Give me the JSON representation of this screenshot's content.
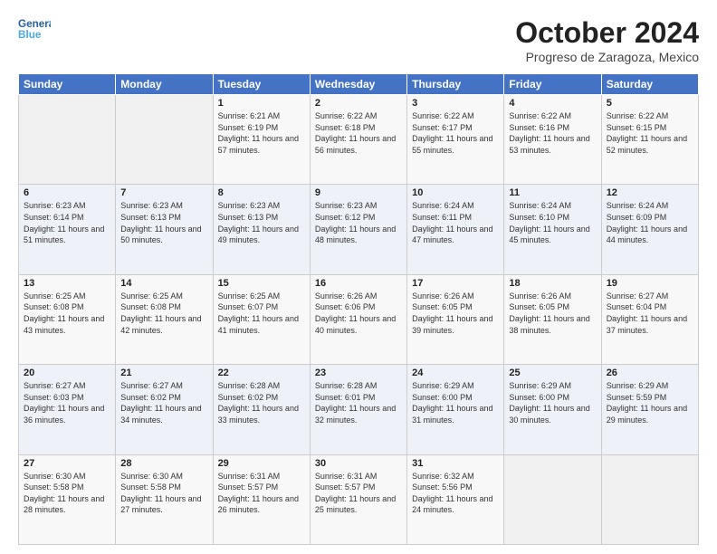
{
  "header": {
    "month_title": "October 2024",
    "location": "Progreso de Zaragoza, Mexico",
    "logo_general": "General",
    "logo_blue": "Blue"
  },
  "days_of_week": [
    "Sunday",
    "Monday",
    "Tuesday",
    "Wednesday",
    "Thursday",
    "Friday",
    "Saturday"
  ],
  "weeks": [
    [
      {
        "day": "",
        "sunrise": "",
        "sunset": "",
        "daylight": ""
      },
      {
        "day": "",
        "sunrise": "",
        "sunset": "",
        "daylight": ""
      },
      {
        "day": "1",
        "sunrise": "Sunrise: 6:21 AM",
        "sunset": "Sunset: 6:19 PM",
        "daylight": "Daylight: 11 hours and 57 minutes."
      },
      {
        "day": "2",
        "sunrise": "Sunrise: 6:22 AM",
        "sunset": "Sunset: 6:18 PM",
        "daylight": "Daylight: 11 hours and 56 minutes."
      },
      {
        "day": "3",
        "sunrise": "Sunrise: 6:22 AM",
        "sunset": "Sunset: 6:17 PM",
        "daylight": "Daylight: 11 hours and 55 minutes."
      },
      {
        "day": "4",
        "sunrise": "Sunrise: 6:22 AM",
        "sunset": "Sunset: 6:16 PM",
        "daylight": "Daylight: 11 hours and 53 minutes."
      },
      {
        "day": "5",
        "sunrise": "Sunrise: 6:22 AM",
        "sunset": "Sunset: 6:15 PM",
        "daylight": "Daylight: 11 hours and 52 minutes."
      }
    ],
    [
      {
        "day": "6",
        "sunrise": "Sunrise: 6:23 AM",
        "sunset": "Sunset: 6:14 PM",
        "daylight": "Daylight: 11 hours and 51 minutes."
      },
      {
        "day": "7",
        "sunrise": "Sunrise: 6:23 AM",
        "sunset": "Sunset: 6:13 PM",
        "daylight": "Daylight: 11 hours and 50 minutes."
      },
      {
        "day": "8",
        "sunrise": "Sunrise: 6:23 AM",
        "sunset": "Sunset: 6:13 PM",
        "daylight": "Daylight: 11 hours and 49 minutes."
      },
      {
        "day": "9",
        "sunrise": "Sunrise: 6:23 AM",
        "sunset": "Sunset: 6:12 PM",
        "daylight": "Daylight: 11 hours and 48 minutes."
      },
      {
        "day": "10",
        "sunrise": "Sunrise: 6:24 AM",
        "sunset": "Sunset: 6:11 PM",
        "daylight": "Daylight: 11 hours and 47 minutes."
      },
      {
        "day": "11",
        "sunrise": "Sunrise: 6:24 AM",
        "sunset": "Sunset: 6:10 PM",
        "daylight": "Daylight: 11 hours and 45 minutes."
      },
      {
        "day": "12",
        "sunrise": "Sunrise: 6:24 AM",
        "sunset": "Sunset: 6:09 PM",
        "daylight": "Daylight: 11 hours and 44 minutes."
      }
    ],
    [
      {
        "day": "13",
        "sunrise": "Sunrise: 6:25 AM",
        "sunset": "Sunset: 6:08 PM",
        "daylight": "Daylight: 11 hours and 43 minutes."
      },
      {
        "day": "14",
        "sunrise": "Sunrise: 6:25 AM",
        "sunset": "Sunset: 6:08 PM",
        "daylight": "Daylight: 11 hours and 42 minutes."
      },
      {
        "day": "15",
        "sunrise": "Sunrise: 6:25 AM",
        "sunset": "Sunset: 6:07 PM",
        "daylight": "Daylight: 11 hours and 41 minutes."
      },
      {
        "day": "16",
        "sunrise": "Sunrise: 6:26 AM",
        "sunset": "Sunset: 6:06 PM",
        "daylight": "Daylight: 11 hours and 40 minutes."
      },
      {
        "day": "17",
        "sunrise": "Sunrise: 6:26 AM",
        "sunset": "Sunset: 6:05 PM",
        "daylight": "Daylight: 11 hours and 39 minutes."
      },
      {
        "day": "18",
        "sunrise": "Sunrise: 6:26 AM",
        "sunset": "Sunset: 6:05 PM",
        "daylight": "Daylight: 11 hours and 38 minutes."
      },
      {
        "day": "19",
        "sunrise": "Sunrise: 6:27 AM",
        "sunset": "Sunset: 6:04 PM",
        "daylight": "Daylight: 11 hours and 37 minutes."
      }
    ],
    [
      {
        "day": "20",
        "sunrise": "Sunrise: 6:27 AM",
        "sunset": "Sunset: 6:03 PM",
        "daylight": "Daylight: 11 hours and 36 minutes."
      },
      {
        "day": "21",
        "sunrise": "Sunrise: 6:27 AM",
        "sunset": "Sunset: 6:02 PM",
        "daylight": "Daylight: 11 hours and 34 minutes."
      },
      {
        "day": "22",
        "sunrise": "Sunrise: 6:28 AM",
        "sunset": "Sunset: 6:02 PM",
        "daylight": "Daylight: 11 hours and 33 minutes."
      },
      {
        "day": "23",
        "sunrise": "Sunrise: 6:28 AM",
        "sunset": "Sunset: 6:01 PM",
        "daylight": "Daylight: 11 hours and 32 minutes."
      },
      {
        "day": "24",
        "sunrise": "Sunrise: 6:29 AM",
        "sunset": "Sunset: 6:00 PM",
        "daylight": "Daylight: 11 hours and 31 minutes."
      },
      {
        "day": "25",
        "sunrise": "Sunrise: 6:29 AM",
        "sunset": "Sunset: 6:00 PM",
        "daylight": "Daylight: 11 hours and 30 minutes."
      },
      {
        "day": "26",
        "sunrise": "Sunrise: 6:29 AM",
        "sunset": "Sunset: 5:59 PM",
        "daylight": "Daylight: 11 hours and 29 minutes."
      }
    ],
    [
      {
        "day": "27",
        "sunrise": "Sunrise: 6:30 AM",
        "sunset": "Sunset: 5:58 PM",
        "daylight": "Daylight: 11 hours and 28 minutes."
      },
      {
        "day": "28",
        "sunrise": "Sunrise: 6:30 AM",
        "sunset": "Sunset: 5:58 PM",
        "daylight": "Daylight: 11 hours and 27 minutes."
      },
      {
        "day": "29",
        "sunrise": "Sunrise: 6:31 AM",
        "sunset": "Sunset: 5:57 PM",
        "daylight": "Daylight: 11 hours and 26 minutes."
      },
      {
        "day": "30",
        "sunrise": "Sunrise: 6:31 AM",
        "sunset": "Sunset: 5:57 PM",
        "daylight": "Daylight: 11 hours and 25 minutes."
      },
      {
        "day": "31",
        "sunrise": "Sunrise: 6:32 AM",
        "sunset": "Sunset: 5:56 PM",
        "daylight": "Daylight: 11 hours and 24 minutes."
      },
      {
        "day": "",
        "sunrise": "",
        "sunset": "",
        "daylight": ""
      },
      {
        "day": "",
        "sunrise": "",
        "sunset": "",
        "daylight": ""
      }
    ]
  ]
}
